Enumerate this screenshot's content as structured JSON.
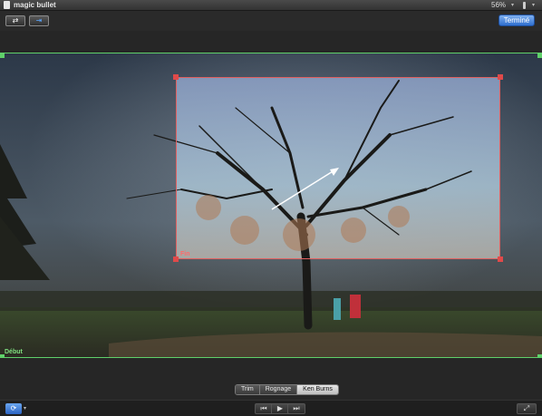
{
  "window": {
    "title": "magic bullet",
    "zoom": "56%",
    "zoom_caret": "▾",
    "volume_caret": "▾"
  },
  "toolbar": {
    "swap_icon": "⇄",
    "match_icon": "⇥",
    "done_label": "Terminé"
  },
  "viewer": {
    "start_label": "Début",
    "end_label": "Fin",
    "start_frame_color": "#5fd06a",
    "end_frame_color": "#e04a4a"
  },
  "modes": {
    "items": [
      "Trim",
      "Rognage",
      "Ken Burns"
    ],
    "selected": "Ken Burns"
  },
  "playback": {
    "loop_icon": "⟳",
    "loop_caret": "▾",
    "prev_icon": "⏮",
    "play_icon": "▶",
    "next_icon": "⏭",
    "fullscreen_icon": "⤢"
  }
}
